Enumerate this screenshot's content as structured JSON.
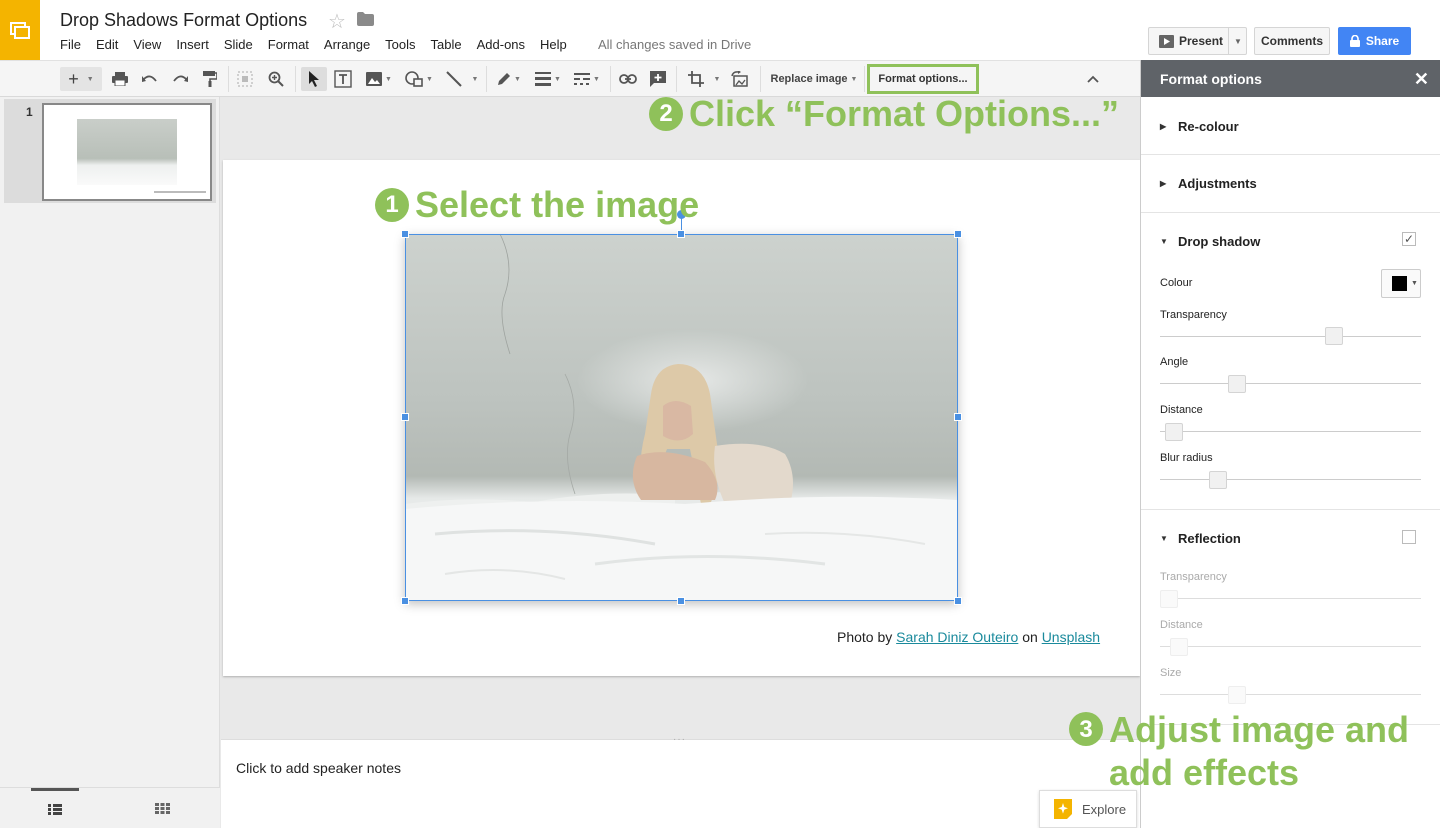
{
  "header": {
    "doc_title": "Drop Shadows Format Options",
    "star_icon": "star-outline-icon",
    "folder_icon": "folder-icon",
    "menu": [
      "File",
      "Edit",
      "View",
      "Insert",
      "Slide",
      "Format",
      "Arrange",
      "Tools",
      "Table",
      "Add-ons",
      "Help"
    ],
    "save_status": "All changes saved in Drive",
    "present_label": "Present",
    "comments_label": "Comments",
    "share_label": "Share"
  },
  "toolbar": {
    "replace_image_label": "Replace image",
    "format_options_label": "Format options..."
  },
  "filmstrip": {
    "slide_number": "1"
  },
  "slide": {
    "caption_prefix": "Photo by",
    "caption_author": "Sarah Diniz Outeiro",
    "caption_mid": "on",
    "caption_site": "Unsplash"
  },
  "annotations": {
    "step1_num": "1",
    "step1_text": "Select the image",
    "step2_num": "2",
    "step2_text": "Click “Format Options...”",
    "step3_num": "3",
    "step3_line1": "Adjust image and",
    "step3_line2": "add effects",
    "color": "#8fc15a"
  },
  "notes": {
    "placeholder": "Click to add speaker notes",
    "explore_label": "Explore"
  },
  "panel": {
    "title": "Format options",
    "recolour": "Re-colour",
    "adjustments": "Adjustments",
    "drop_shadow": "Drop shadow",
    "drop_shadow_checked": true,
    "colour_label": "Colour",
    "colour_value": "#000000",
    "transparency_label": "Transparency",
    "angle_label": "Angle",
    "distance_label": "Distance",
    "blur_label": "Blur radius",
    "shadow_levels": {
      "transparency": 0.68,
      "angle": 0.28,
      "distance": 0.02,
      "blur": 0.2
    },
    "reflection": "Reflection",
    "reflection_checked": false,
    "ref_transparency_label": "Transparency",
    "ref_distance_label": "Distance",
    "ref_size_label": "Size",
    "reflection_levels": {
      "transparency": 0.0,
      "distance": 0.04,
      "size": 0.28
    }
  }
}
